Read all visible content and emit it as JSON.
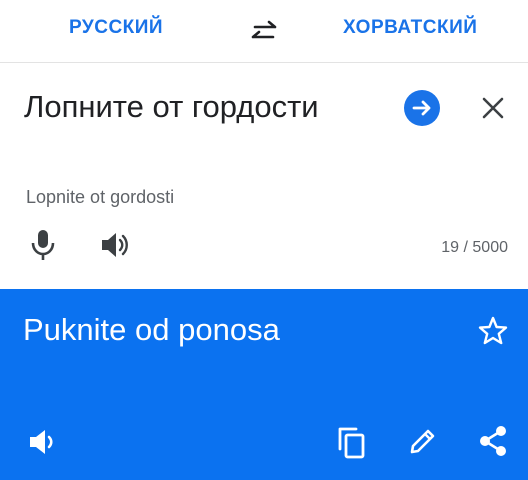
{
  "languages": {
    "source": "РУССКИЙ",
    "target": "ХОРВАТСКИЙ"
  },
  "input": {
    "text": "Лопните от гордости",
    "transliteration": "Lopnite ot gordosti",
    "char_count": "19 / 5000"
  },
  "output": {
    "text": "Puknite od ponosa"
  },
  "colors": {
    "accent": "#1a73e8",
    "output_bg": "#0b72f0"
  },
  "icons": [
    "swap-icon",
    "arrow-right-icon",
    "close-icon",
    "microphone-icon",
    "speaker-icon",
    "star-icon",
    "copy-icon",
    "edit-icon",
    "share-icon"
  ]
}
